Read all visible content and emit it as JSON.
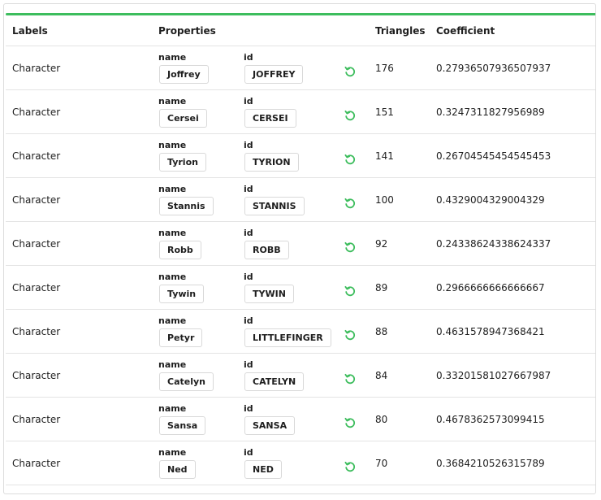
{
  "table": {
    "headers": {
      "labels": "Labels",
      "properties": "Properties",
      "triangles": "Triangles",
      "coefficient": "Coefficient"
    },
    "name_key": "name",
    "id_key": "id",
    "rows": [
      {
        "label": "Character",
        "name": "Joffrey",
        "id": "JOFFREY",
        "triangles": "176",
        "coefficient": "0.27936507936507937"
      },
      {
        "label": "Character",
        "name": "Cersei",
        "id": "CERSEI",
        "triangles": "151",
        "coefficient": "0.3247311827956989"
      },
      {
        "label": "Character",
        "name": "Tyrion",
        "id": "TYRION",
        "triangles": "141",
        "coefficient": "0.26704545454545453"
      },
      {
        "label": "Character",
        "name": "Stannis",
        "id": "STANNIS",
        "triangles": "100",
        "coefficient": "0.4329004329004329"
      },
      {
        "label": "Character",
        "name": "Robb",
        "id": "ROBB",
        "triangles": "92",
        "coefficient": "0.24338624338624337"
      },
      {
        "label": "Character",
        "name": "Tywin",
        "id": "TYWIN",
        "triangles": "89",
        "coefficient": "0.2966666666666667"
      },
      {
        "label": "Character",
        "name": "Petyr",
        "id": "LITTLEFINGER",
        "triangles": "88",
        "coefficient": "0.4631578947368421"
      },
      {
        "label": "Character",
        "name": "Catelyn",
        "id": "CATELYN",
        "triangles": "84",
        "coefficient": "0.33201581027667987"
      },
      {
        "label": "Character",
        "name": "Sansa",
        "id": "SANSA",
        "triangles": "80",
        "coefficient": "0.4678362573099415"
      },
      {
        "label": "Character",
        "name": "Ned",
        "id": "NED",
        "triangles": "70",
        "coefficient": "0.3684210526315789"
      }
    ]
  },
  "icons": {
    "row_action": "refresh-icon"
  },
  "colors": {
    "accent": "#3dbd5d"
  }
}
